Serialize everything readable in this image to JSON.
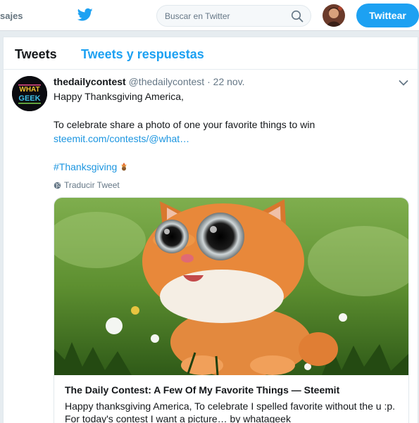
{
  "topbar": {
    "messages_label": "sajes",
    "search_placeholder": "Buscar en Twitter",
    "tweet_button": "Twittear"
  },
  "tabs": [
    {
      "label": "Tweets",
      "active": true
    },
    {
      "label": "Tweets y respuestas",
      "active": false
    }
  ],
  "tweet": {
    "name": "thedailycontest",
    "handle": "@thedailycontest",
    "dot": "·",
    "date": "22 nov.",
    "avatar_text": "WHAT GEEK",
    "lines": {
      "line1": "Happy Thanksgiving America,",
      "line2": "To celebrate share a photo of one your favorite things to win",
      "link": "steemit.com/contests/@what…",
      "hashtag": "#Thanksgiving"
    },
    "translate_label": "Traducir Tweet",
    "card": {
      "title": "The Daily Contest: A Few Of My Favorite Things — Steemit",
      "desc_line1": "Happy thanksgiving America, To celebrate I spelled favorite without the u :p.",
      "desc_line2": "For today's contest I want a picture… by whatageek"
    }
  },
  "colors": {
    "accent": "#1da1f2",
    "link": "#1b95e0",
    "muted": "#657786"
  },
  "icons": [
    "twitter-bird-icon",
    "search-icon",
    "chevron-down-icon",
    "globe-icon",
    "turkey-emoji-icon"
  ]
}
